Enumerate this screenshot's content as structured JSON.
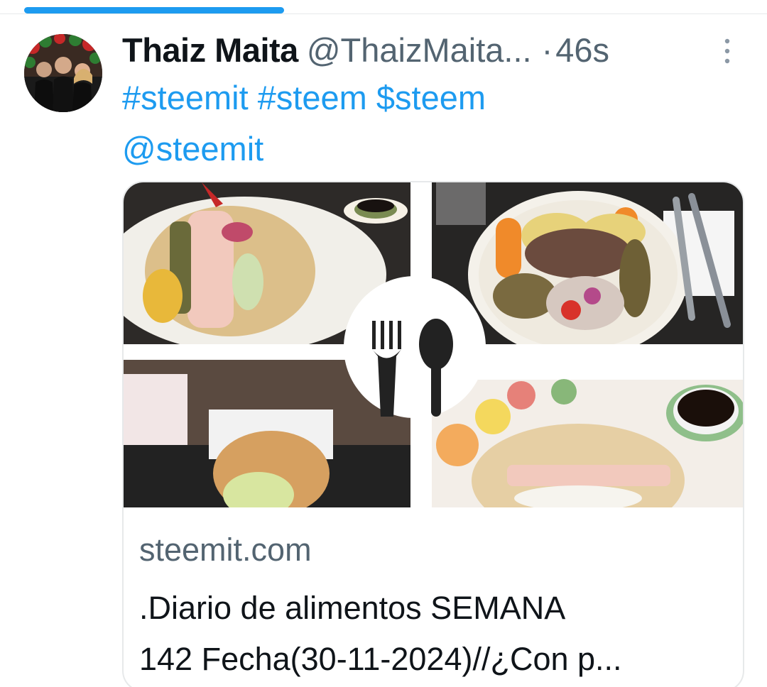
{
  "status": {
    "progress_percent": 35
  },
  "tweet": {
    "display_name": "Thaiz Maita",
    "handle": "@ThaizMaita...",
    "separator": "·",
    "time": "46s",
    "avatar_icon": "profile-photo",
    "more_icon": "more-vertical-icon",
    "text": {
      "tag1": "#steemit",
      "tag2": "#steem",
      "cashtag": "$steem",
      "mention": "@steemit"
    }
  },
  "card": {
    "domain": "steemit.com",
    "title_line1": ".Diario de alimentos SEMANA",
    "title_line2": "142 Fecha(30-11-2024)//¿Con p...",
    "center_icon": "fork-spoon-icon"
  },
  "colors": {
    "accent": "#1d9bf0",
    "text_primary": "#0f1419",
    "text_secondary": "#536471",
    "border": "#e7e9ea"
  }
}
